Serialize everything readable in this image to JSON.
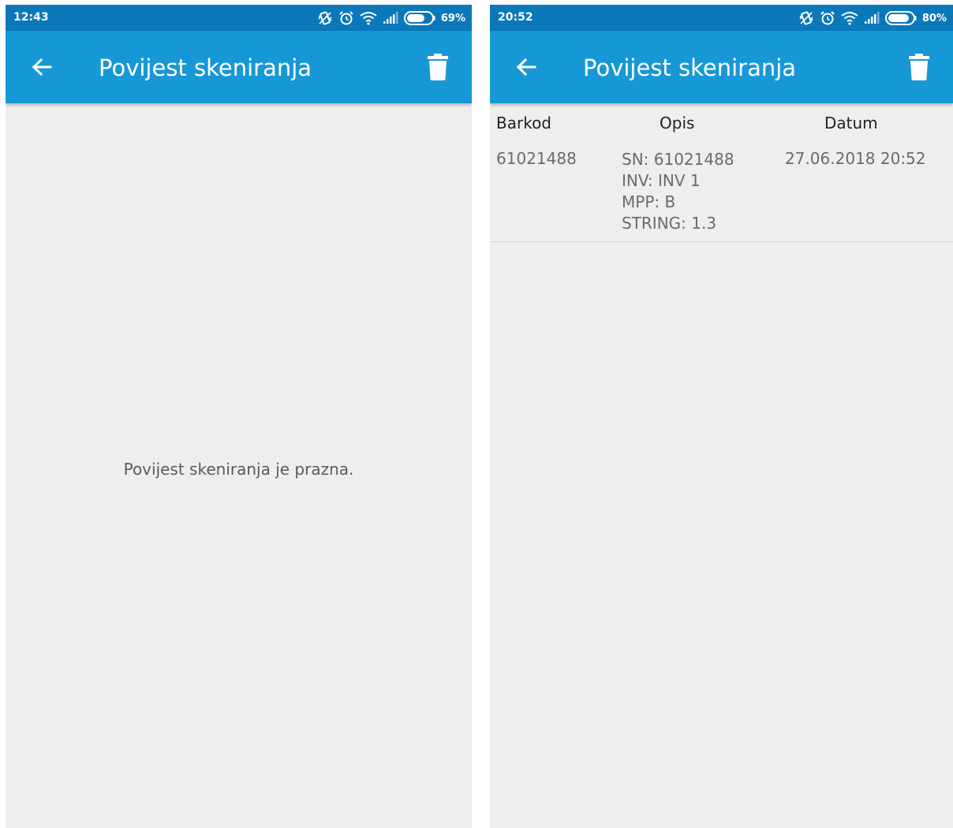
{
  "screens": [
    {
      "status_bar": {
        "time": "12:43",
        "battery": "69%"
      },
      "app_bar": {
        "title": "Povijest skeniranja"
      },
      "empty_message": "Povijest skeniranja je prazna."
    },
    {
      "status_bar": {
        "time": "20:52",
        "battery": "80%"
      },
      "app_bar": {
        "title": "Povijest skeniranja"
      },
      "table": {
        "columns": [
          "Barkod",
          "Opis",
          "Datum"
        ],
        "rows": [
          {
            "barkod": "61021488",
            "opis": [
              "SN: 61021488",
              "INV: INV 1",
              "MPP: B",
              "STRING: 1.3"
            ],
            "datum": "27.06.2018 20:52"
          }
        ]
      }
    }
  ],
  "icons": {
    "back": "arrow-left-icon",
    "delete": "trash-icon",
    "status": [
      "vibrate-icon",
      "alarm-icon",
      "wifi-icon",
      "signal-icon",
      "battery-icon"
    ]
  },
  "colors": {
    "status_bar": "#0b78ba",
    "app_bar": "#1798d6",
    "background": "#eeeeee",
    "text_primary": "#222222",
    "text_secondary": "#6a6a6a"
  }
}
